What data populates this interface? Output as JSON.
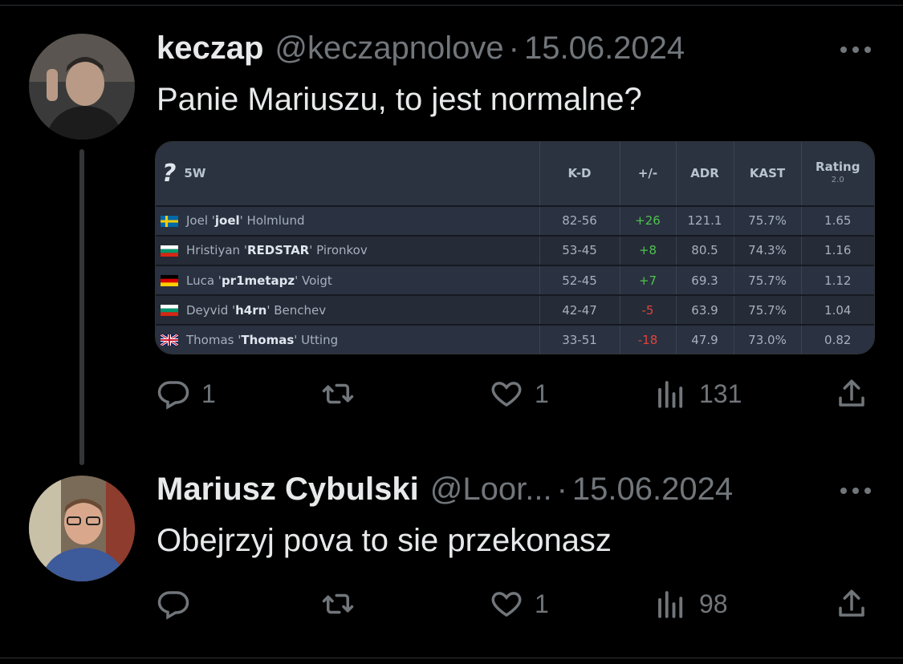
{
  "tweets": [
    {
      "name": "keczap",
      "handle": "@keczapnolove",
      "separator": "·",
      "date": "15.06.2024",
      "text": "Panie Mariuszu, to jest normalne?",
      "avatar_icon": "user-avatar",
      "stats": {
        "replies": "1",
        "retweets": "",
        "likes": "1",
        "views": "131"
      }
    },
    {
      "name": "Mariusz Cybulski",
      "handle": "@Loor...",
      "separator": "·",
      "date": "15.06.2024",
      "text": "Obejrzyj pova to sie przekonasz",
      "avatar_icon": "user-avatar",
      "stats": {
        "replies": "",
        "retweets": "",
        "likes": "1",
        "views": "98"
      }
    }
  ],
  "scoreboard": {
    "team_icon": "?",
    "team_name": "5W",
    "columns": {
      "kd": "K-D",
      "diff": "+/-",
      "adr": "ADR",
      "kast": "KAST",
      "rating": "Rating",
      "rating_version": "2.0"
    },
    "players": [
      {
        "first": "Joel '",
        "nick": "joel",
        "last": "' Holmlund",
        "flag": "SE",
        "kd": "82-56",
        "diff": "+26",
        "adr": "121.1",
        "kast": "75.7%",
        "rating": "1.65"
      },
      {
        "first": "Hristiyan '",
        "nick": "REDSTAR",
        "last": "' Pironkov",
        "flag": "BG",
        "kd": "53-45",
        "diff": "+8",
        "adr": "80.5",
        "kast": "74.3%",
        "rating": "1.16"
      },
      {
        "first": "Luca '",
        "nick": "pr1metapz",
        "last": "' Voigt",
        "flag": "DE",
        "kd": "52-45",
        "diff": "+7",
        "adr": "69.3",
        "kast": "75.7%",
        "rating": "1.12"
      },
      {
        "first": "Deyvid '",
        "nick": "h4rn",
        "last": "' Benchev",
        "flag": "BG",
        "kd": "42-47",
        "diff": "-5",
        "adr": "63.9",
        "kast": "75.7%",
        "rating": "1.04"
      },
      {
        "first": "Thomas '",
        "nick": "Thomas",
        "last": "' Utting",
        "flag": "GB",
        "kd": "33-51",
        "diff": "-18",
        "adr": "47.9",
        "kast": "73.0%",
        "rating": "0.82"
      }
    ]
  },
  "colors": {
    "background": "#000000",
    "text": "#e7e9ea",
    "muted": "#71767b",
    "positive": "#4fc24f",
    "negative": "#e0433d"
  }
}
